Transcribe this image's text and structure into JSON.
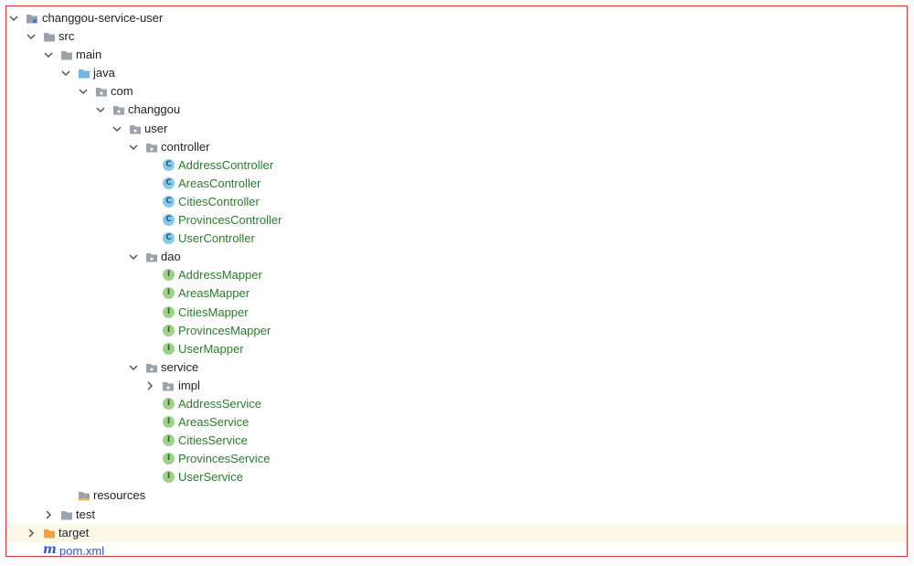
{
  "tree": {
    "root": {
      "label": "changgou-service-user",
      "icon": "module-folder-icon"
    },
    "src": {
      "label": "src"
    },
    "main": {
      "label": "main"
    },
    "java": {
      "label": "java"
    },
    "com": {
      "label": "com"
    },
    "changgou": {
      "label": "changgou"
    },
    "user": {
      "label": "user"
    },
    "controller": {
      "label": "controller",
      "classes": [
        "AddressController",
        "AreasController",
        "CitiesController",
        "ProvincesController",
        "UserController"
      ],
      "badge": "C"
    },
    "dao": {
      "label": "dao",
      "interfaces": [
        "AddressMapper",
        "AreasMapper",
        "CitiesMapper",
        "ProvincesMapper",
        "UserMapper"
      ],
      "badge": "I"
    },
    "service": {
      "label": "service",
      "impl": "impl",
      "interfaces": [
        "AddressService",
        "AreasService",
        "CitiesService",
        "ProvincesService",
        "UserService"
      ],
      "badge": "I"
    },
    "resources": {
      "label": "resources"
    },
    "test": {
      "label": "test"
    },
    "target": {
      "label": "target"
    },
    "pom": {
      "label": "pom.xml",
      "icon_glyph": "m"
    }
  },
  "colors": {
    "frame": "#e2333a",
    "java_class_text": "#2a7b2a",
    "class_badge": "#8ac8e8",
    "interface_badge": "#9fd08d",
    "folder_gray": "#9aa3ad",
    "source_folder_blue": "#6fb7e0",
    "excluded_folder_orange": "#f0a24a",
    "selected_row": "#fbf9e6"
  }
}
